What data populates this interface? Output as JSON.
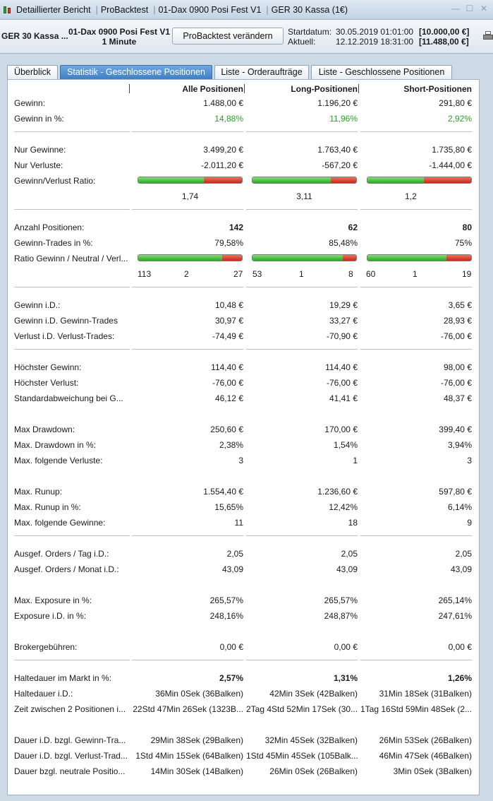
{
  "window": {
    "title_parts": [
      "Detaillierter Bericht",
      "ProBacktest",
      "01-Dax 0900 Posi Fest V1",
      "GER 30 Kassa (1€)"
    ]
  },
  "info": {
    "instrument": "GER 30 Kassa ...",
    "strategy": "01-Dax 0900 Posi Fest V1",
    "timeframe": "1 Minute",
    "modify_button": "ProBacktest verändern",
    "start_label": "Startdatum:",
    "start_date": "30.05.2019 01:01:00",
    "start_capital": "[10.000,00 €]",
    "current_label": "Aktuell:",
    "current_date": "12.12.2019 18:31:00",
    "current_capital": "[11.488,00 €]"
  },
  "tabs": [
    {
      "label": "Überblick"
    },
    {
      "label": "Statistik - Geschlossene Positionen"
    },
    {
      "label": "Liste - Orderaufträge"
    },
    {
      "label": "Liste - Geschlossene Positionen"
    }
  ],
  "headers": {
    "all": "Alle Positionen",
    "long": "Long-Positionen",
    "short": "Short-Positionen"
  },
  "rows": [
    {
      "label": "Gewinn:",
      "v": [
        "1.488,00 €",
        "1.196,20 €",
        "291,80 €"
      ]
    },
    {
      "label": "Gewinn in %:",
      "v": [
        "14,88%",
        "11,96%",
        "2,92%"
      ]
    },
    {
      "label": "Nur Gewinne:",
      "v": [
        "3.499,20 €",
        "1.763,40 €",
        "1.735,80 €"
      ]
    },
    {
      "label": "Nur Verluste:",
      "v": [
        "-2.011,20 €",
        "-567,20 €",
        "-1.444,00 €"
      ]
    },
    {
      "label": "Gewinn/Verlust Ratio:",
      "v": [
        "1,74",
        "3,11",
        "1,2"
      ]
    },
    {
      "label": "Anzahl Positionen:",
      "v": [
        "142",
        "62",
        "80"
      ]
    },
    {
      "label": "Gewinn-Trades in %:",
      "v": [
        "79,58%",
        "85,48%",
        "75%"
      ]
    },
    {
      "label": "Ratio Gewinn / Neutral / Verl...",
      "v": [
        [
          "113",
          "2",
          "27"
        ],
        [
          "53",
          "1",
          "8"
        ],
        [
          "60",
          "1",
          "19"
        ]
      ]
    },
    {
      "label": "Gewinn i.D.:",
      "v": [
        "10,48 €",
        "19,29 €",
        "3,65 €"
      ]
    },
    {
      "label": "Gewinn i.D. Gewinn-Trades",
      "v": [
        "30,97 €",
        "33,27 €",
        "28,93 €"
      ]
    },
    {
      "label": "Verlust i.D. Verlust-Trades:",
      "v": [
        "-74,49 €",
        "-70,90 €",
        "-76,00 €"
      ]
    },
    {
      "label": "Höchster Gewinn:",
      "v": [
        "114,40 €",
        "114,40 €",
        "98,00 €"
      ]
    },
    {
      "label": "Höchster Verlust:",
      "v": [
        "-76,00 €",
        "-76,00 €",
        "-76,00 €"
      ]
    },
    {
      "label": "Standardabweichung bei G...",
      "v": [
        "46,12 €",
        "41,41 €",
        "48,37 €"
      ]
    },
    {
      "label": "Max Drawdown:",
      "v": [
        "250,60 €",
        "170,00 €",
        "399,40 €"
      ]
    },
    {
      "label": "Max. Drawdown in %:",
      "v": [
        "2,38%",
        "1,54%",
        "3,94%"
      ]
    },
    {
      "label": "Max. folgende Verluste:",
      "v": [
        "3",
        "1",
        "3"
      ]
    },
    {
      "label": "Max. Runup:",
      "v": [
        "1.554,40 €",
        "1.236,60 €",
        "597,80 €"
      ]
    },
    {
      "label": "Max. Runup in %:",
      "v": [
        "15,65%",
        "12,42%",
        "6,14%"
      ]
    },
    {
      "label": "Max. folgende Gewinne:",
      "v": [
        "11",
        "18",
        "9"
      ]
    },
    {
      "label": "Ausgef. Orders / Tag i.D.:",
      "v": [
        "2,05",
        "2,05",
        "2,05"
      ]
    },
    {
      "label": "Ausgef. Orders / Monat i.D.:",
      "v": [
        "43,09",
        "43,09",
        "43,09"
      ]
    },
    {
      "label": "Max. Exposure in %:",
      "v": [
        "265,57%",
        "265,57%",
        "265,14%"
      ]
    },
    {
      "label": "Exposure i.D. in %:",
      "v": [
        "248,16%",
        "248,87%",
        "247,61%"
      ]
    },
    {
      "label": "Brokergebühren:",
      "v": [
        "0,00 €",
        "0,00 €",
        "0,00 €"
      ]
    },
    {
      "label": "Haltedauer im Markt in %:",
      "v": [
        "2,57%",
        "1,31%",
        "1,26%"
      ]
    },
    {
      "label": "Haltedauer i.D.:",
      "v": [
        "36Min 0Sek (36Balken)",
        "42Min 3Sek (42Balken)",
        "31Min 18Sek (31Balken)"
      ]
    },
    {
      "label": "Zeit zwischen 2 Positionen i...",
      "v": [
        "22Std 47Min 26Sek (1323B...",
        "2Tag 4Std 52Min 17Sek (30...",
        "1Tag 16Std 59Min 48Sek (2..."
      ]
    },
    {
      "label": "Dauer i.D. bzgl. Gewinn-Tra...",
      "v": [
        "29Min 38Sek (29Balken)",
        "32Min 45Sek (32Balken)",
        "26Min 53Sek (26Balken)"
      ]
    },
    {
      "label": "Dauer i.D. bzgl. Verlust-Trad...",
      "v": [
        "1Std 4Min 15Sek (64Balken)",
        "1Std 45Min 45Sek (105Balk...",
        "46Min 47Sek (46Balken)"
      ]
    },
    {
      "label": "Dauer bzgl. neutrale Positio...",
      "v": [
        "14Min 30Sek (14Balken)",
        "26Min 0Sek (26Balken)",
        "3Min 0Sek (3Balken)"
      ]
    }
  ],
  "bars": {
    "gv_ratio_green_fraction": [
      0.635,
      0.757,
      0.546
    ],
    "gnv_green_fraction": [
      0.796,
      0.855,
      0.75
    ],
    "gnv_neutral_fraction": [
      0.014,
      0.016,
      0.013
    ]
  },
  "colors": {
    "positive": "#27a327",
    "bar_green": "#2fa52a",
    "bar_red": "#c42a1a",
    "tab_active": "#3f7fc4"
  }
}
